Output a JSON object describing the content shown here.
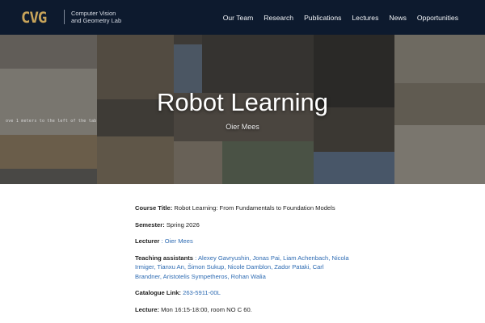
{
  "header": {
    "logo_text": "CVG",
    "lab_name_line1": "Computer Vision",
    "lab_name_line2": "and Geometry Lab",
    "nav": [
      "Our Team",
      "Research",
      "Publications",
      "Lectures",
      "News",
      "Opportunities"
    ]
  },
  "hero": {
    "title": "Robot Learning",
    "subtitle": "Oier Mees",
    "caption": "ove 1 meters to the left of the tab"
  },
  "course": {
    "title_label": "Course Title:",
    "title_value": "Robot Learning: From Fundamentals to Foundation Models",
    "semester_label": "Semester:",
    "semester_value": "Spring 2026",
    "lecturer_label": "Lecturer",
    "lecturer_sep": " : ",
    "lecturer_value": "Oier Mees",
    "ta_label": "Teaching assistants",
    "ta_sep": " : ",
    "ta_names": [
      "Alexey Gavryushin",
      "Jonas Pai",
      "Liam Achenbach",
      "Nicola Irmiger",
      "Tianxu An",
      "Šimon Sukup",
      "Nicole Damblon",
      "Zador Pataki",
      "Carl Brandner",
      "Aristotelis Sympetheros",
      "Rohan Walia"
    ],
    "catalogue_label": "Catalogue Link:",
    "catalogue_value": "263-5911-00L",
    "lecture_label": "Lecture:",
    "lecture_value": "Mon 16:15-18:00, room NO C 60."
  },
  "colors": {
    "navbar_bg": "#0d1a2e",
    "logo_gold": "#c8a45a",
    "link_blue": "#2f6cb3"
  }
}
